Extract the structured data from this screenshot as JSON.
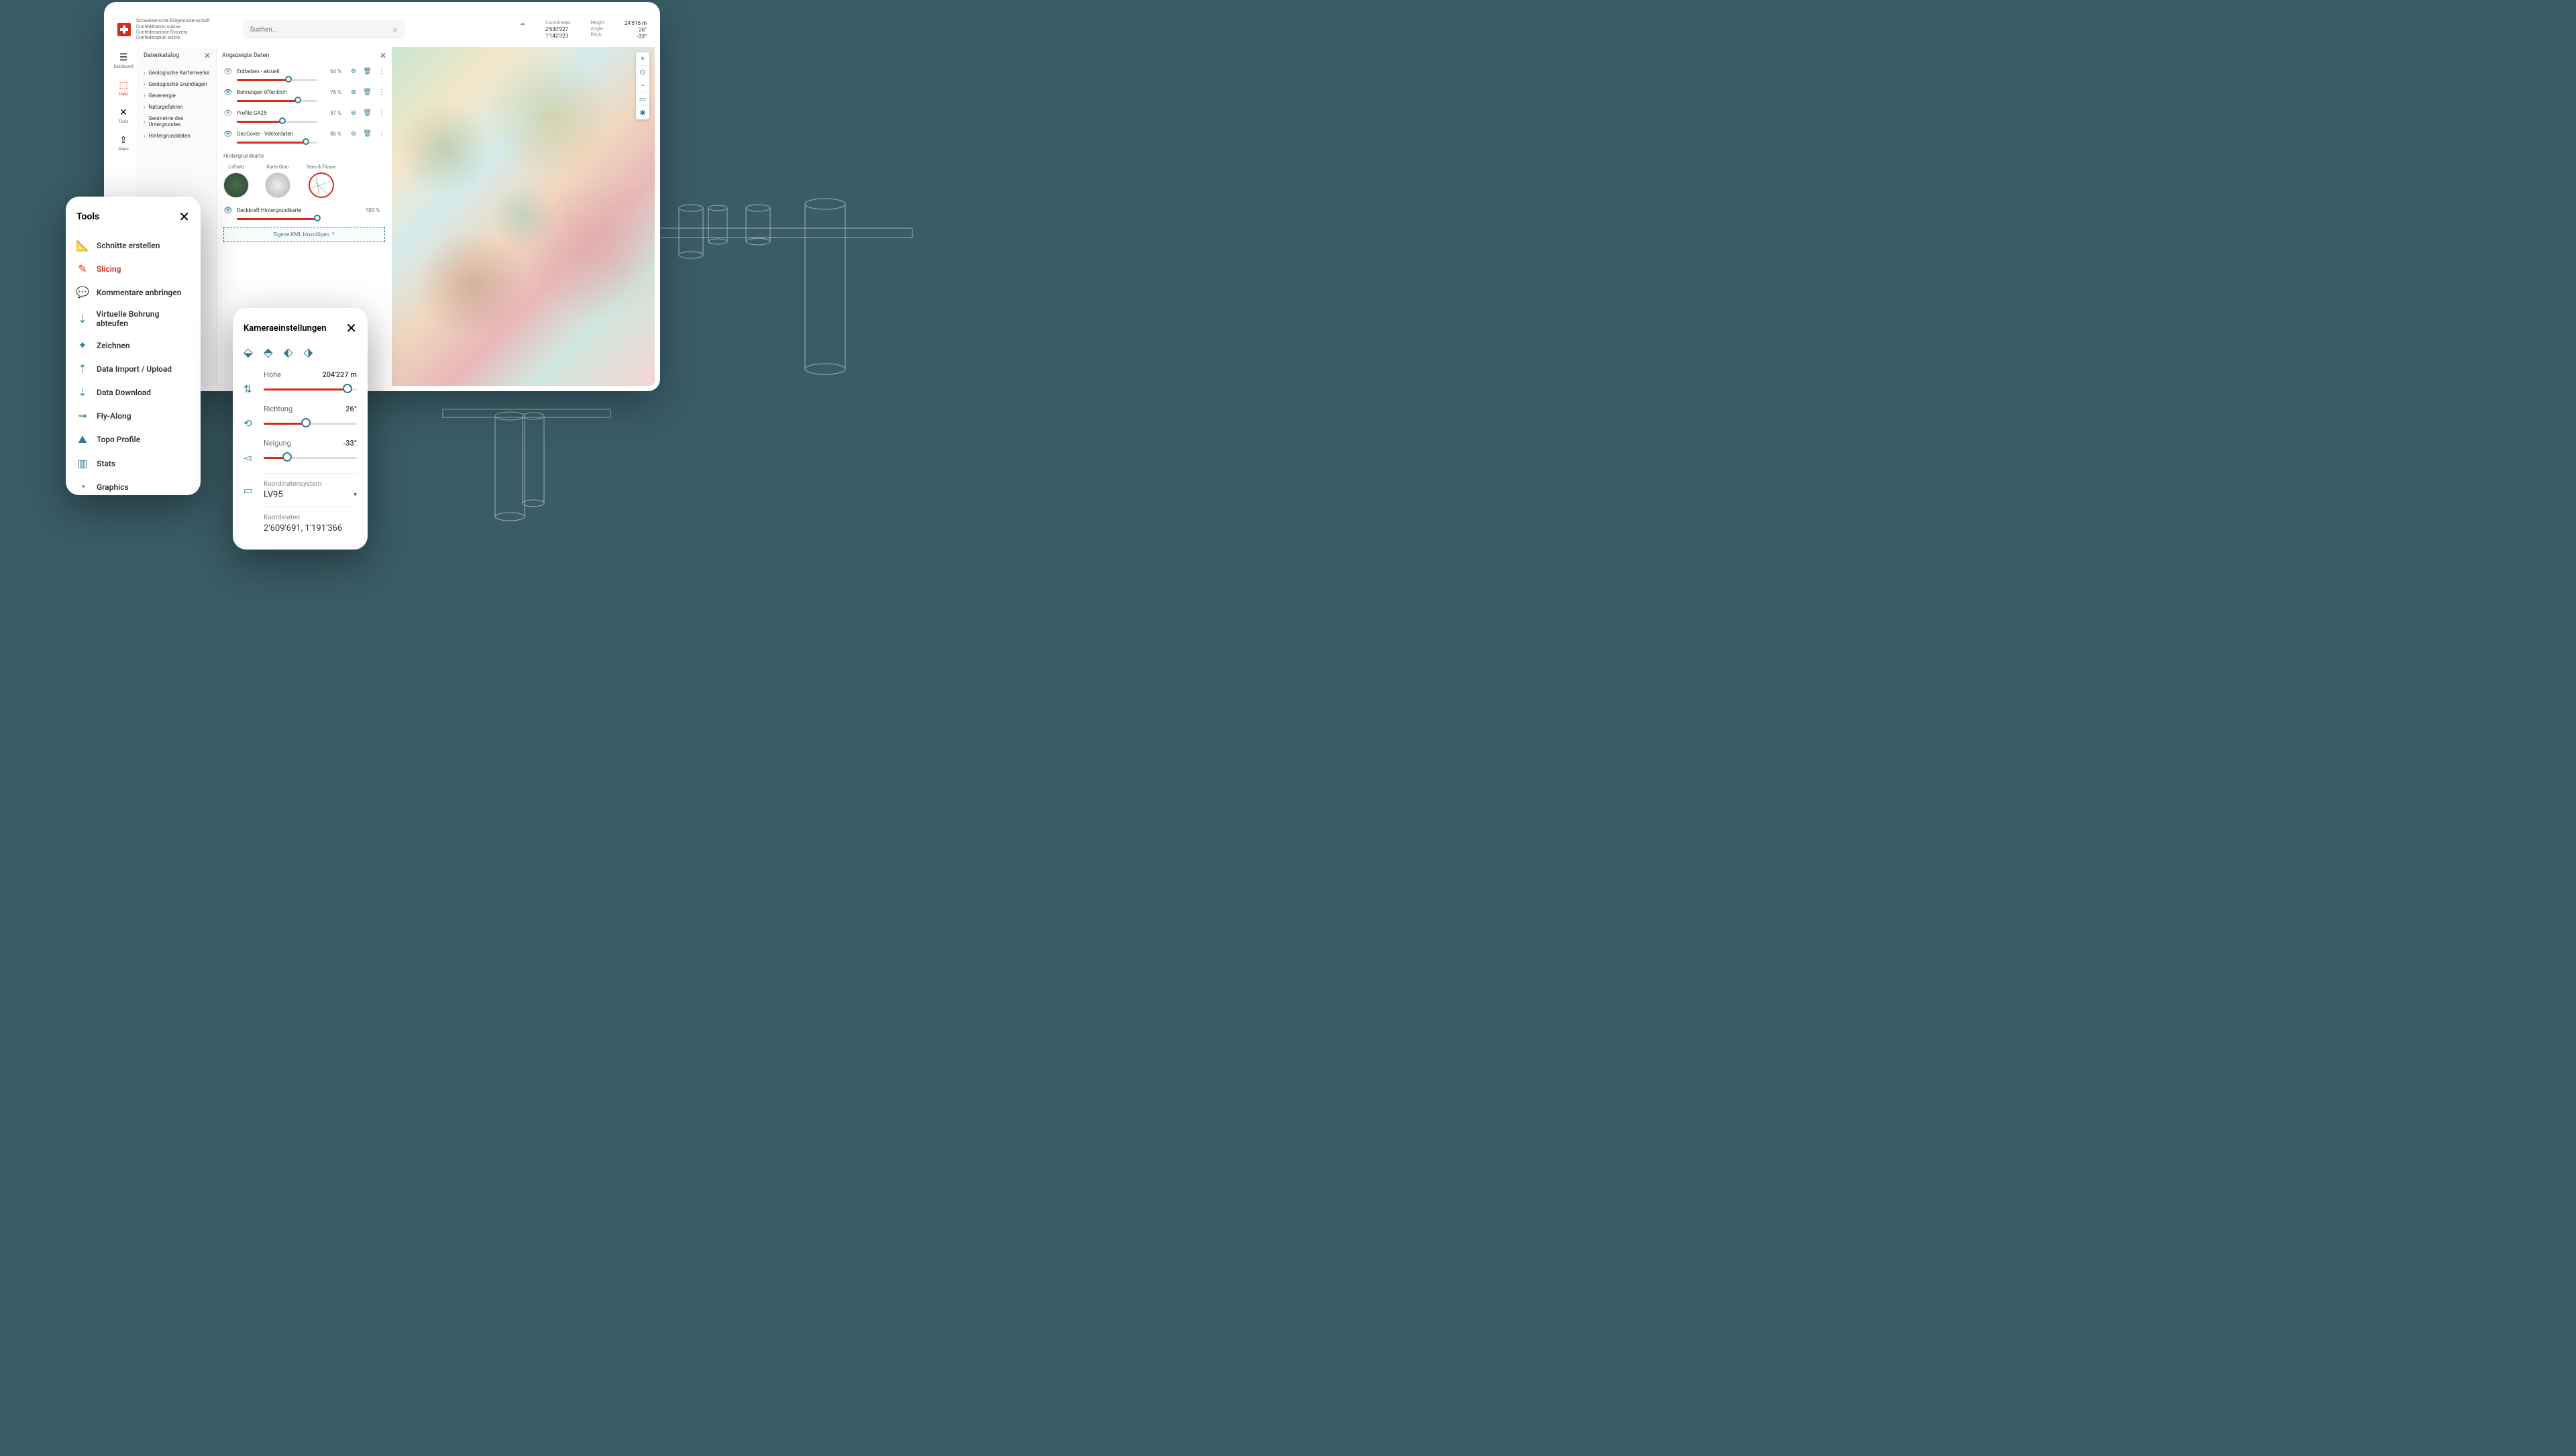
{
  "header": {
    "org_lines": [
      "Schweizerische Eidgenossenschaft",
      "Confédération suisse",
      "Confederazione Svizzera",
      "Confederaziun svizra"
    ],
    "search_placeholder": "Suchen...",
    "coords": {
      "coord_label": "Coordinates",
      "coord_x": "2'630'927",
      "coord_y": "1'142'323",
      "height_label": "Height",
      "height_value": "24'515 m",
      "angle_label": "Angle",
      "angle_value": "26°",
      "pitch_label": "Pitch",
      "pitch_value": "-33°"
    }
  },
  "rail": {
    "dashboard": "Dashboard",
    "data": "Data",
    "tools": "Tools",
    "share": "Share"
  },
  "catalog": {
    "title": "Datenkatalog",
    "items": [
      "Geologische Kartenwerke",
      "Geologische Grundlagen",
      "Geoenergie",
      "Naturgefahren",
      "Geometrie des Untergrundes",
      "Hintergrunddaten"
    ]
  },
  "displayed": {
    "title": "Angezeigte Daten",
    "layers": [
      {
        "name": "Erdbeben - aktuell",
        "pct": "64 %",
        "p": 64,
        "visible": false
      },
      {
        "name": "Bohrungen öffentlich",
        "pct": "76 %",
        "p": 76,
        "visible": true
      },
      {
        "name": "Profile GA25",
        "pct": "57 %",
        "p": 57,
        "visible": false
      },
      {
        "name": "GeoCover - Vektordaten",
        "pct": "86 %",
        "p": 86,
        "visible": true
      }
    ],
    "bg_title": "Hintergrundkarte",
    "bg_options": [
      "Luftbild",
      "Karte Grau",
      "Seen & Flüsse"
    ],
    "opacity_label": "Deckkraft Hintergrundkarte",
    "opacity_pct": "100 %",
    "opacity_p": 100,
    "kml": "Eigene KML hinzufügen"
  },
  "tools": {
    "title": "Tools",
    "items": [
      {
        "label": "Schnitte erstellen",
        "icon": "📐"
      },
      {
        "label": "Slicing",
        "icon": "✎",
        "active": true
      },
      {
        "label": "Kommentare anbringen",
        "icon": "💬"
      },
      {
        "label": "Virtuelle Bohrung abteufen",
        "icon": "⇣"
      },
      {
        "label": "Zeichnen",
        "icon": "✦"
      },
      {
        "label": "Data Import / Upload",
        "icon": "⇡"
      },
      {
        "label": "Data Download",
        "icon": "⇣"
      },
      {
        "label": "Fly-Along",
        "icon": "⇝"
      },
      {
        "label": "Topo Profile",
        "icon": "⛰"
      },
      {
        "label": "Stats",
        "icon": "▥"
      },
      {
        "label": "Graphics",
        "icon": "◔"
      }
    ]
  },
  "camera": {
    "title": "Kameraeinstellungen",
    "rows": [
      {
        "label": "Höhe",
        "value": "204'227 m",
        "p": 90
      },
      {
        "label": "Richtung",
        "value": "26°",
        "p": 45
      },
      {
        "label": "Neigung",
        "value": "-33°",
        "p": 25
      }
    ],
    "coord_sys_label": "Koordinatensystem",
    "coord_sys_value": "LV95",
    "coords_label": "Koordinaten",
    "coords_value": "2'609'691, 1'191'366"
  }
}
